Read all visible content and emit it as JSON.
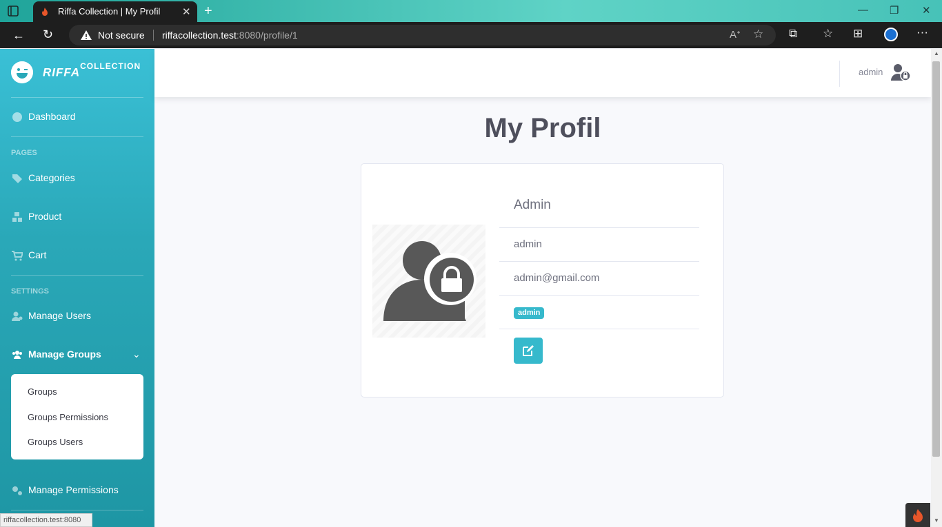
{
  "browser": {
    "tab_title": "Riffa Collection | My Profil",
    "security_label": "Not secure",
    "url_host": "riffacollection.test",
    "url_path": ":8080/profile/1",
    "status_url": "riffacollection.test:8080"
  },
  "brand": {
    "name": "RIFFA",
    "suffix": "COLLECTION"
  },
  "sidebar": {
    "dashboard": "Dashboard",
    "pages_heading": "PAGES",
    "categories": "Categories",
    "product": "Product",
    "cart": "Cart",
    "settings_heading": "SETTINGS",
    "manage_users": "Manage Users",
    "manage_groups": "Manage Groups",
    "groups_submenu": [
      "Groups",
      "Groups Permissions",
      "Groups Users"
    ],
    "manage_permissions": "Manage Permissions"
  },
  "topbar": {
    "username": "admin"
  },
  "page": {
    "title": "My Profil"
  },
  "profile": {
    "full_name": "Admin",
    "username": "admin",
    "email": "admin@gmail.com",
    "role": "admin"
  },
  "colors": {
    "accent": "#36b9cc",
    "sidebar": "#2aa8b8",
    "text": "#4e4f5c"
  }
}
